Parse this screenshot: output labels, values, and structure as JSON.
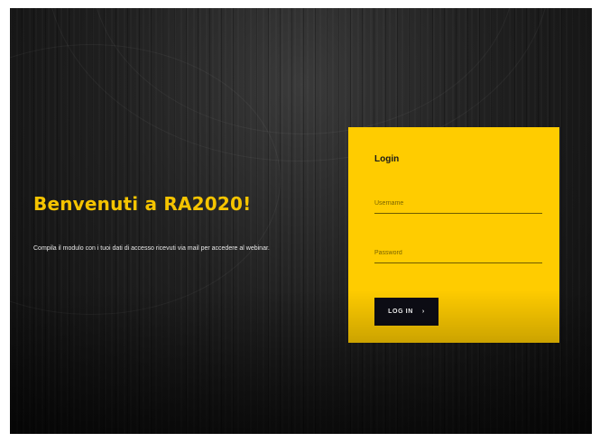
{
  "hero": {
    "title": "Benvenuti a RA2020!",
    "description": "Compila il modulo con i tuoi dati di accesso ricevuti via mail per accedere al webinar."
  },
  "login": {
    "heading": "Login",
    "username_placeholder": "Username",
    "username_value": "",
    "password_placeholder": "Password",
    "password_value": "",
    "button_label": "LOG IN",
    "button_icon": "arrow-right-icon"
  },
  "colors": {
    "background": "#111111",
    "accent": "#ffcc00",
    "title": "#f5c400",
    "button": "#0d0d15"
  }
}
